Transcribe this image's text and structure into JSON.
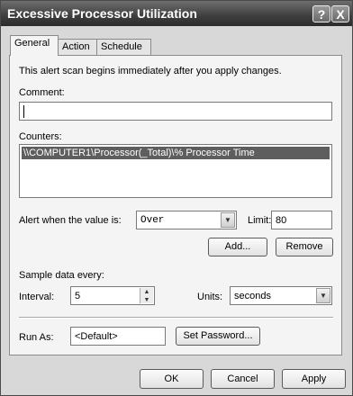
{
  "window": {
    "title": "Excessive Processor Utilization",
    "help_glyph": "?",
    "close_glyph": "X"
  },
  "tabs": [
    {
      "label": "General"
    },
    {
      "label": "Action"
    },
    {
      "label": "Schedule"
    }
  ],
  "general": {
    "info_text": "This alert scan begins immediately after you apply changes.",
    "comment_label": "Comment:",
    "comment_value": "",
    "counters_label": "Counters:",
    "counters": [
      "\\\\COMPUTER1\\Processor(_Total)\\% Processor Time"
    ],
    "alert_label": "Alert when the value is:",
    "alert_condition": "Over",
    "limit_label": "Limit:",
    "limit_value": "80",
    "add_label": "Add...",
    "remove_label": "Remove",
    "sample_label": "Sample data every:",
    "interval_label": "Interval:",
    "interval_value": "5",
    "units_label": "Units:",
    "units_value": "seconds",
    "runas_label": "Run As:",
    "runas_value": "<Default>",
    "set_password_label": "Set Password..."
  },
  "footer": {
    "ok_label": "OK",
    "cancel_label": "Cancel",
    "apply_label": "Apply"
  }
}
